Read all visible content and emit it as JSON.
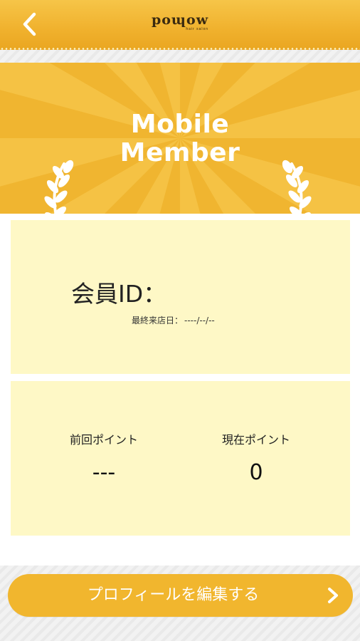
{
  "header": {
    "logo_text": "poɰow",
    "logo_subtext": "hair salon",
    "back_icon": "chevron-left-icon"
  },
  "banner": {
    "title_line1": "Mobile",
    "title_line2": "Member",
    "laurel_icon": "laurel-icon",
    "colors": {
      "background": "#f5c244",
      "rays": "#f0b530"
    }
  },
  "member": {
    "id_label": "会員ID：",
    "last_visit_label": "最終来店日：",
    "last_visit_value": "----/--/--"
  },
  "points": {
    "previous_label": "前回ポイント",
    "previous_value": "---",
    "current_label": "現在ポイント",
    "current_value": "0"
  },
  "cta": {
    "label": "プロフィールを編集する",
    "icon": "chevron-right-icon",
    "color": "#f1b62e"
  }
}
